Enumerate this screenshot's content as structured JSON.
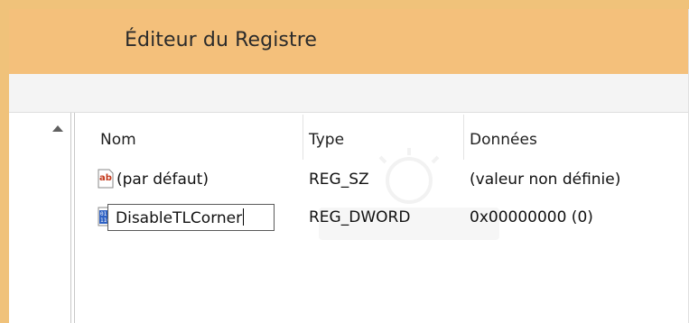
{
  "window": {
    "title": "Éditeur du Registre"
  },
  "columns": {
    "name": "Nom",
    "type": "Type",
    "data": "Données"
  },
  "rows": [
    {
      "name": "(par défaut)",
      "type": "REG_SZ",
      "data": "(valeur non définie)",
      "icon": "string-value-icon"
    },
    {
      "name": "DisableTLCorner",
      "type": "REG_DWORD",
      "data": "0x00000000 (0)",
      "icon": "binary-value-icon",
      "editing": true
    }
  ],
  "colors": {
    "titlebar": "#f4c07b",
    "accent_string_icon": "#c4391b",
    "accent_binary_icon": "#2f62c4"
  }
}
